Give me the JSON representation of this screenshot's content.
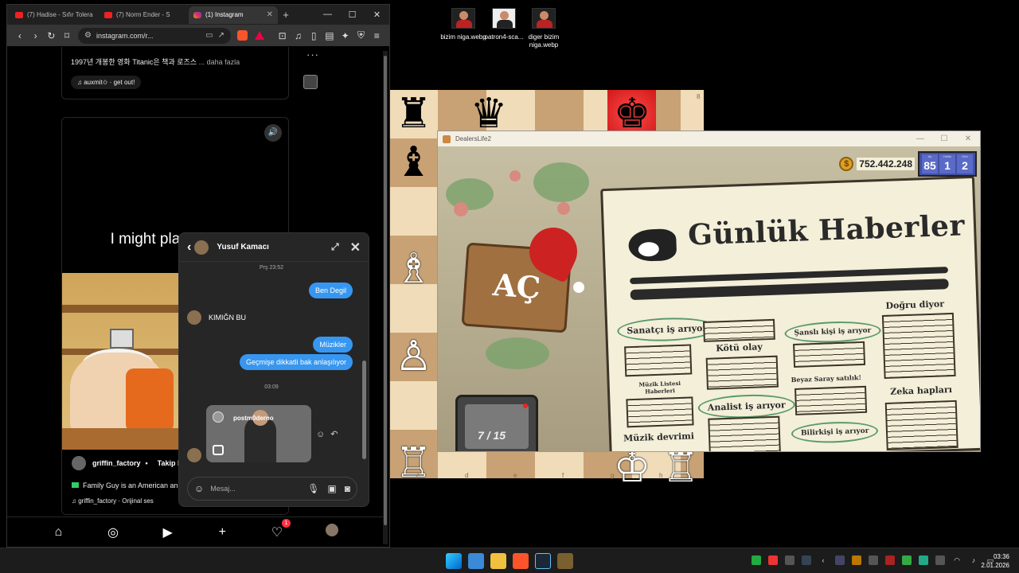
{
  "desktop": {
    "icons": [
      {
        "label": "bizim niga.webp"
      },
      {
        "label": "patron4-sca..."
      },
      {
        "label": "diger bizim niga.webp"
      }
    ]
  },
  "browser": {
    "tabs": [
      {
        "label": "(7) Hadise - Sıfır Tolera"
      },
      {
        "label": "(7) Norm Ender - S"
      },
      {
        "label": "(1) Instagram",
        "active": true
      }
    ],
    "url": "instagram.com/r...",
    "window_controls": {
      "minimize": "—",
      "maximize": "☐",
      "close": "✕"
    }
  },
  "instagram": {
    "prev_post": {
      "caption": "1997년 개봉한 영화 Titanic은 책과 로즈스",
      "more": "... daha fazla",
      "audio": "auxmit✩ · get out!"
    },
    "reel": {
      "overlay_text": "I might playe wrong",
      "username": "griffin_factory",
      "follow_label": "Takip Et",
      "description": "Family Guy is an American ani",
      "audio": "griffin_factory · Orijinal ses"
    },
    "bottom_nav": {
      "notification_count": "1"
    }
  },
  "chat": {
    "contact_name": "Yusuf Kamacı",
    "timestamp_1": "Prş 23:52",
    "messages": [
      {
        "from": "me",
        "text": "Ben Degil"
      },
      {
        "from": "them",
        "text": "KIMIĞN BU"
      },
      {
        "from": "me",
        "text": "Müzikler"
      },
      {
        "from": "me",
        "text": "Geçmişe dikkatli bak anlaşılıyor"
      }
    ],
    "timestamp_2": "03:09",
    "shared_reel": {
      "username": "postm0derno"
    },
    "input_placeholder": "Mesaj..."
  },
  "chess": {
    "file_labels": [
      "c",
      "d",
      "e",
      "f",
      "g",
      "h"
    ],
    "rank_label": "8"
  },
  "dealers": {
    "window_title": "DealersLife2",
    "money": "752.442.248",
    "calendar": [
      {
        "label": "Ay",
        "value": "85"
      },
      {
        "label": "Hafta",
        "value": "1"
      },
      {
        "label": "Gün",
        "value": "2"
      }
    ],
    "open_sign": "AÇ",
    "counter": "7 / 15",
    "newspaper": {
      "title": "Günlük Haberler",
      "headlines": {
        "h1": "Sanatçı iş arıyor",
        "h2": "Kötü olay",
        "h3": "Şanslı kişi iş arıyor",
        "h4": "Doğru diyor",
        "h5": "Müzik Listesi Haberleri",
        "h6": "Beyaz Saray satılık!",
        "h7": "Zeka hapları",
        "h8": "Analist iş arıyor",
        "h9": "Müzik devrimi",
        "h10": "Bilirkişi iş arıyor"
      }
    }
  },
  "taskbar": {
    "time": "03:36",
    "date": "2.01.2026"
  }
}
